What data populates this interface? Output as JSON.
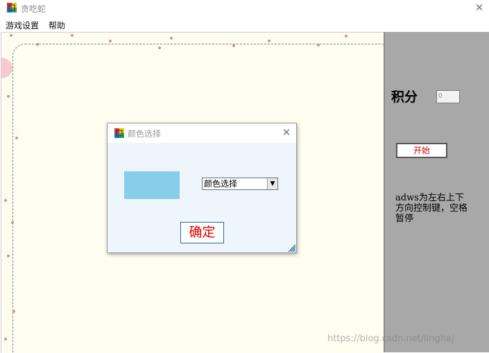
{
  "window": {
    "title": "贪吃蛇",
    "close_symbol": "✕"
  },
  "menu": {
    "items": [
      "游戏设置",
      "帮助"
    ]
  },
  "side_panel": {
    "score_label": "积分",
    "score_value": "0",
    "start_label": "开始",
    "help_text": "adws为左右上下方向控制键，空格暂停"
  },
  "dialog": {
    "title": "颜色选择",
    "close_symbol": "✕",
    "swatch_color": "#87ceeb",
    "combo_value": "颜色选择",
    "combo_arrow": "▼",
    "ok_label": "确定"
  },
  "watermark": "https://blog.csdn.net/linghaj",
  "colors": {
    "game_bg": "#fefdf0",
    "panel_bg": "#a8a8a8",
    "dialog_bg": "#eef5fc",
    "accent_red": "#e00000"
  },
  "icons": [
    "app-icon",
    "close-icon",
    "dialog-icon",
    "dialog-close-icon",
    "dropdown-arrow-icon",
    "resize-grip-icon"
  ]
}
